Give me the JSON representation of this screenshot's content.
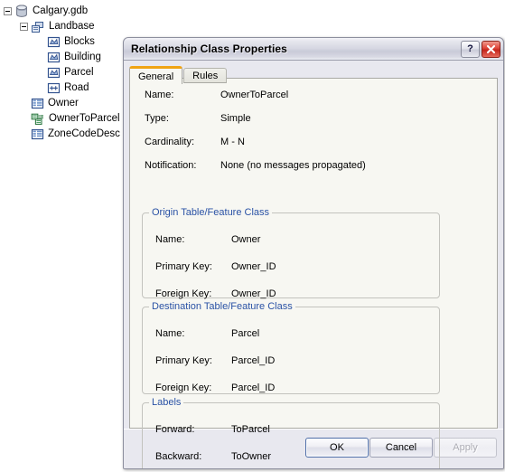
{
  "tree": {
    "nodes": [
      {
        "label": "Calgary.gdb",
        "icon": "geodatabase-icon",
        "depth": 0,
        "expander": true
      },
      {
        "label": "Landbase",
        "icon": "feature-dataset-icon",
        "depth": 1,
        "expander": true
      },
      {
        "label": "Blocks",
        "icon": "polygon-feature-class-icon",
        "depth": 2,
        "expander": false
      },
      {
        "label": "Building",
        "icon": "polygon-feature-class-icon",
        "depth": 2,
        "expander": false
      },
      {
        "label": "Parcel",
        "icon": "polygon-feature-class-icon",
        "depth": 2,
        "expander": false
      },
      {
        "label": "Road",
        "icon": "line-feature-class-icon",
        "depth": 2,
        "expander": false
      },
      {
        "label": "Owner",
        "icon": "table-icon",
        "depth": 1,
        "expander": false
      },
      {
        "label": "OwnerToParcel",
        "icon": "relationship-class-icon",
        "depth": 1,
        "expander": false
      },
      {
        "label": "ZoneCodeDesc",
        "icon": "table-icon",
        "depth": 1,
        "expander": false
      }
    ]
  },
  "dialog": {
    "title": "Relationship Class Properties",
    "help_label": "?",
    "close_label": "✕",
    "tabs": [
      {
        "label": "General",
        "active": true
      },
      {
        "label": "Rules",
        "active": false
      }
    ],
    "general": {
      "fields": [
        {
          "label": "Name:",
          "value": "OwnerToParcel"
        },
        {
          "label": "Type:",
          "value": "Simple"
        },
        {
          "label": "Cardinality:",
          "value": "M - N"
        },
        {
          "label": "Notification:",
          "value": "None (no messages propagated)"
        }
      ],
      "groups": [
        {
          "title": "Origin Table/Feature Class",
          "rows": [
            {
              "label": "Name:",
              "value": "Owner"
            },
            {
              "label": "Primary Key:",
              "value": "Owner_ID"
            },
            {
              "label": "Foreign Key:",
              "value": "Owner_ID"
            }
          ]
        },
        {
          "title": "Destination Table/Feature Class",
          "rows": [
            {
              "label": "Name:",
              "value": "Parcel"
            },
            {
              "label": "Primary Key:",
              "value": "Parcel_ID"
            },
            {
              "label": "Foreign Key:",
              "value": "Parcel_ID"
            }
          ]
        },
        {
          "title": "Labels",
          "rows": [
            {
              "label": "Forward:",
              "value": "ToParcel"
            },
            {
              "label": "Backward:",
              "value": "ToOwner"
            }
          ]
        }
      ]
    },
    "buttons": [
      {
        "label": "OK",
        "state": "default"
      },
      {
        "label": "Cancel",
        "state": "normal"
      },
      {
        "label": "Apply",
        "state": "disabled"
      }
    ]
  },
  "colors": {
    "legend_blue": "#2a52a5",
    "tab_accent_orange": "#f0a414",
    "close_red": "#c4251c",
    "panel_bg": "#f7f7f2",
    "dialog_bg": "#e8e8ef"
  }
}
